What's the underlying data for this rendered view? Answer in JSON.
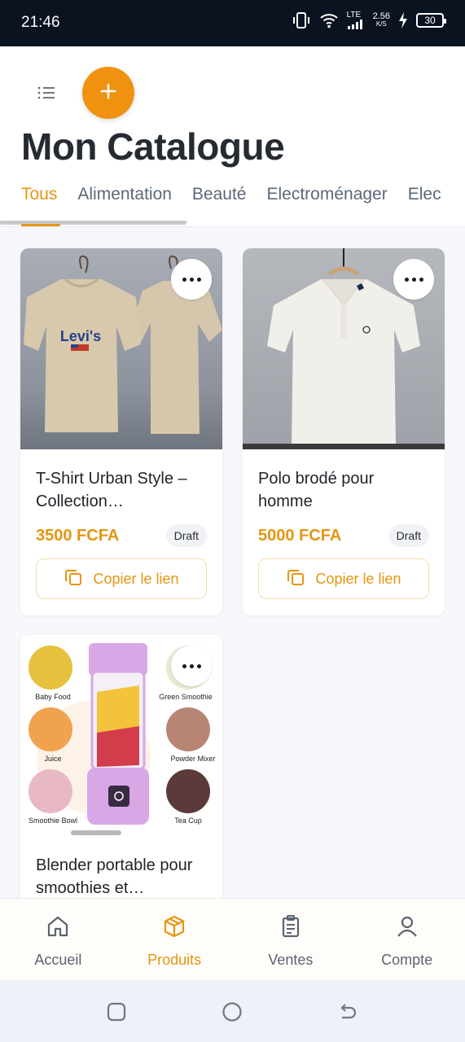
{
  "status_bar": {
    "time": "21:46",
    "network": "LTE",
    "speed_value": "2.56",
    "speed_unit": "K/S",
    "battery": "30"
  },
  "header": {
    "title": "Mon Catalogue",
    "menu_icon": "menu-icon",
    "add_icon": "plus-icon"
  },
  "tabs": [
    {
      "label": "Tous",
      "active": true
    },
    {
      "label": "Alimentation",
      "active": false
    },
    {
      "label": "Beauté",
      "active": false
    },
    {
      "label": "Electroménager",
      "active": false
    },
    {
      "label": "Elec",
      "active": false
    }
  ],
  "products": [
    {
      "title": "T-Shirt Urban Style – Collection…",
      "price": "3500 FCFA",
      "status": "Draft",
      "copy_label": "Copier le lien",
      "image_text": "Levi's"
    },
    {
      "title": "Polo brodé pour homme",
      "price": "5000 FCFA",
      "status": "Draft",
      "copy_label": "Copier le lien"
    },
    {
      "title": "Blender portable pour smoothies et…",
      "image_labels": [
        "Baby Food",
        "Green Smoothie",
        "Juice",
        "Powder Mixer",
        "Smoothie Bowl",
        "Tea Cup"
      ]
    }
  ],
  "bottom_nav": [
    {
      "label": "Accueil",
      "icon": "home-icon",
      "active": false
    },
    {
      "label": "Produits",
      "icon": "box-icon",
      "active": true
    },
    {
      "label": "Ventes",
      "icon": "clipboard-icon",
      "active": false
    },
    {
      "label": "Compte",
      "icon": "user-icon",
      "active": false
    }
  ],
  "colors": {
    "accent": "#f0920f",
    "text_dark": "#262b33",
    "muted": "#5b6876"
  }
}
